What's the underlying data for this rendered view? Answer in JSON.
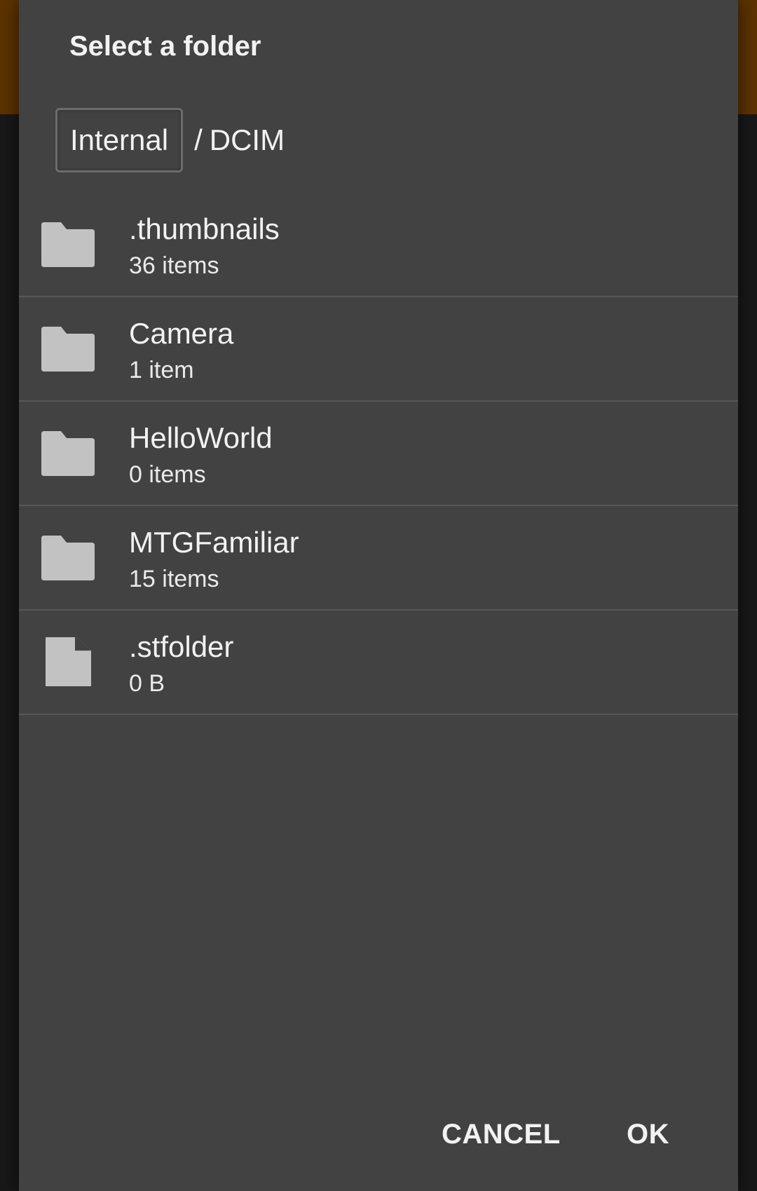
{
  "colors": {
    "app_bar": "#5c3300",
    "dialog_background": "#424242",
    "screen_background": "#181818",
    "divider": "#575757",
    "icon": "#c2c2c2",
    "text": "#f2f2f2"
  },
  "dialog": {
    "title": "Select a folder"
  },
  "breadcrumb": {
    "root": "Internal",
    "separator": "/",
    "current": "DCIM"
  },
  "files": [
    {
      "name": ".thumbnails",
      "meta": "36 items",
      "icon": "folder-icon"
    },
    {
      "name": "Camera",
      "meta": "1 item",
      "icon": "folder-icon"
    },
    {
      "name": "HelloWorld",
      "meta": "0 items",
      "icon": "folder-icon"
    },
    {
      "name": "MTGFamiliar",
      "meta": "15 items",
      "icon": "folder-icon"
    },
    {
      "name": ".stfolder",
      "meta": "0 B",
      "icon": "file-icon"
    }
  ],
  "actions": {
    "cancel_label": "CANCEL",
    "ok_label": "OK"
  }
}
